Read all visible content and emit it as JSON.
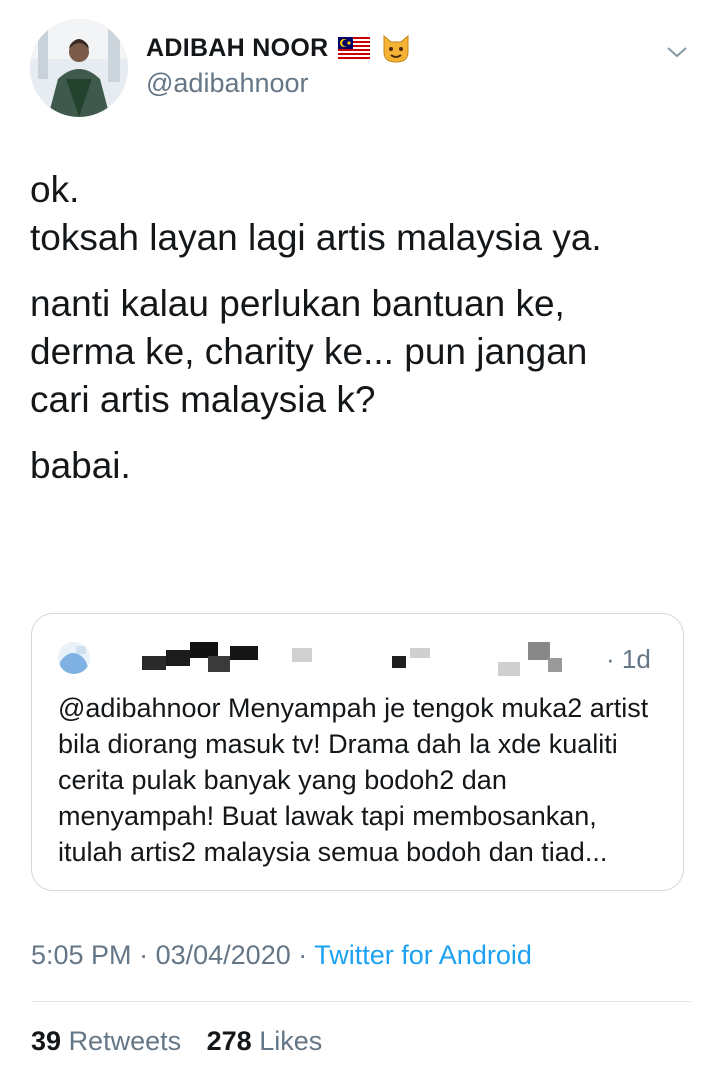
{
  "tweet": {
    "author": {
      "display_name": "ADIBAH NOOR",
      "badges": [
        "malaysia-flag-icon",
        "cat-emoji-icon"
      ],
      "handle": "@adibahnoor"
    },
    "paragraphs": [
      [
        "ok.",
        "toksah layan lagi artis malaysia ya."
      ],
      [
        "nanti kalau perlukan bantuan ke,",
        "derma ke, charity ke... pun jangan",
        "cari artis malaysia k?"
      ],
      [
        "babai."
      ]
    ],
    "quoted": {
      "time": "· 1d",
      "text": "@adibahnoor Menyampah je tengok muka2 artist bila diorang masuk tv! Drama dah la xde kualiti cerita pulak banyak yang bodoh2 dan menyampah! Buat lawak tapi membosankan, itulah artis2 malaysia semua bodoh dan tiad..."
    },
    "meta": {
      "time": "5:05 PM",
      "separator": "·",
      "date": "03/04/2020",
      "source": "Twitter for Android"
    },
    "stats": {
      "retweets_count": "39",
      "retweets_label": "Retweets",
      "likes_count": "278",
      "likes_label": "Likes"
    }
  },
  "colors": {
    "text": "#14171a",
    "secondary": "#657786",
    "link": "#1da1f2",
    "border": "#cfd9de"
  }
}
